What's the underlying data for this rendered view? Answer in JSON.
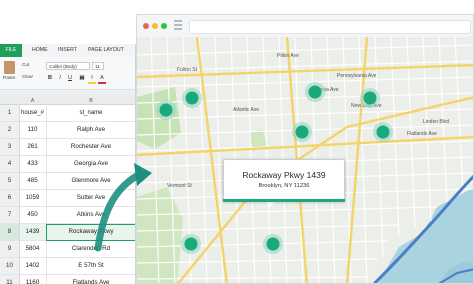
{
  "ribbon": {
    "tabs": [
      "FILE",
      "HOME",
      "INSERT",
      "PAGE LAYOUT"
    ],
    "paste_label": "Paste",
    "cut_label": "Cut",
    "clear_label": "Clear",
    "font_name": "Calibri (Body)",
    "font_size": "11",
    "bold": "B",
    "italic": "I",
    "underline": "U"
  },
  "sheet": {
    "columns": [
      "A",
      "B"
    ],
    "header": {
      "num": "1",
      "a": "house_#",
      "b": "st_name"
    },
    "rows": [
      {
        "num": "2",
        "a": "110",
        "b": "Ralph Ave"
      },
      {
        "num": "3",
        "a": "261",
        "b": "Rochester Ave"
      },
      {
        "num": "4",
        "a": "433",
        "b": "Georgia Ave"
      },
      {
        "num": "5",
        "a": "485",
        "b": "Glenmore Ave"
      },
      {
        "num": "6",
        "a": "1059",
        "b": "Sutter Ave"
      },
      {
        "num": "7",
        "a": "450",
        "b": "Atkins Ave"
      },
      {
        "num": "8",
        "a": "1439",
        "b": "Rockaway Pkwy"
      },
      {
        "num": "9",
        "a": "5804",
        "b": "Clarendon Rd"
      },
      {
        "num": "10",
        "a": "1402",
        "b": "E 57th St"
      },
      {
        "num": "11",
        "a": "1160",
        "b": "Flatlands Ave"
      }
    ],
    "selected_row_index": 6
  },
  "map": {
    "callout_title": "Rockaway Pkwy 1439",
    "callout_subtitle": "Brooklyn, NY 11236",
    "street_labels": [
      "Pitkin Ave",
      "Livonia Ave",
      "New Lots Ave",
      "Linden Blvd",
      "Flatlands Ave",
      "Atlantic Ave",
      "Fulton St",
      "Pennsylvania Ave",
      "Vermont St",
      "Pitkin Ave"
    ],
    "marker_color": "#1aa87c"
  },
  "colors": {
    "excel_green": "#1f9e5c",
    "marker_green": "#1aa87c",
    "arrow_teal": "#1d8f80",
    "water": "#a9d3df",
    "highway_blue": "#4a7fc8",
    "arterial_yellow": "#f4d36a"
  }
}
